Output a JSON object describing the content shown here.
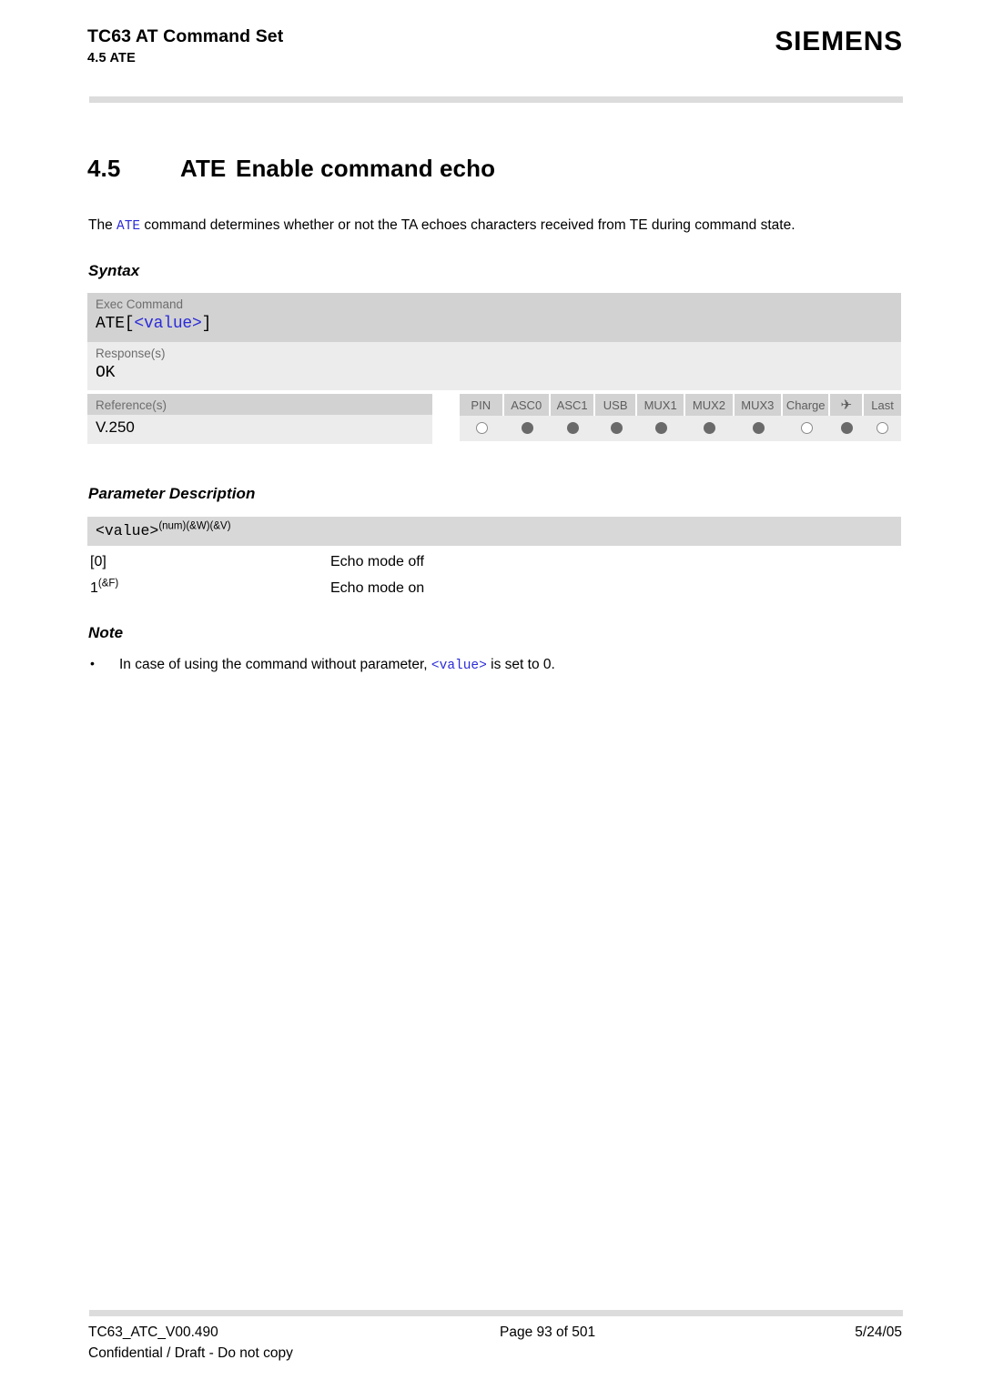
{
  "header": {
    "doc_title": "TC63 AT Command Set",
    "doc_subtitle": "4.5 ATE",
    "brand": "SIEMENS"
  },
  "section": {
    "number": "4.5",
    "command": "ATE",
    "title": "Enable command echo"
  },
  "intro": {
    "before": "The ",
    "code": "ATE",
    "after": " command determines whether or not the TA echoes characters received from TE during command state."
  },
  "syntax": {
    "heading": "Syntax",
    "exec_label": "Exec Command",
    "exec_code_prefix": "ATE[",
    "exec_code_param": "<value>",
    "exec_code_suffix": "]",
    "response_label": "Response(s)",
    "response_value": "OK"
  },
  "references": {
    "label": "Reference(s)",
    "value": "V.250"
  },
  "pin_table": {
    "columns": [
      {
        "label": "PIN",
        "state": "empty"
      },
      {
        "label": "ASC0",
        "state": "filled"
      },
      {
        "label": "ASC1",
        "state": "filled"
      },
      {
        "label": "USB",
        "state": "filled"
      },
      {
        "label": "MUX1",
        "state": "filled"
      },
      {
        "label": "MUX2",
        "state": "filled"
      },
      {
        "label": "MUX3",
        "state": "filled"
      },
      {
        "label": "Charge",
        "state": "empty"
      },
      {
        "label": "✈",
        "state": "filled",
        "icon": "airplane-icon"
      },
      {
        "label": "Last",
        "state": "empty"
      }
    ]
  },
  "parameter_description": {
    "heading": "Parameter Description",
    "param_name": "<value>",
    "param_superscript": "(num)(&W)(&V)",
    "rows": [
      {
        "key": "[0]",
        "sup": "",
        "desc": "Echo mode off"
      },
      {
        "key": "1",
        "sup": "(&F)",
        "desc": "Echo mode on"
      }
    ]
  },
  "note": {
    "heading": "Note",
    "bullet": "•",
    "text_before": "In case of using the command without parameter, ",
    "code": "<value>",
    "text_after": " is set to 0."
  },
  "footer": {
    "doc_id": "TC63_ATC_V00.490",
    "page": "Page 93 of 501",
    "date": "5/24/05",
    "confidential": "Confidential / Draft - Do not copy"
  }
}
